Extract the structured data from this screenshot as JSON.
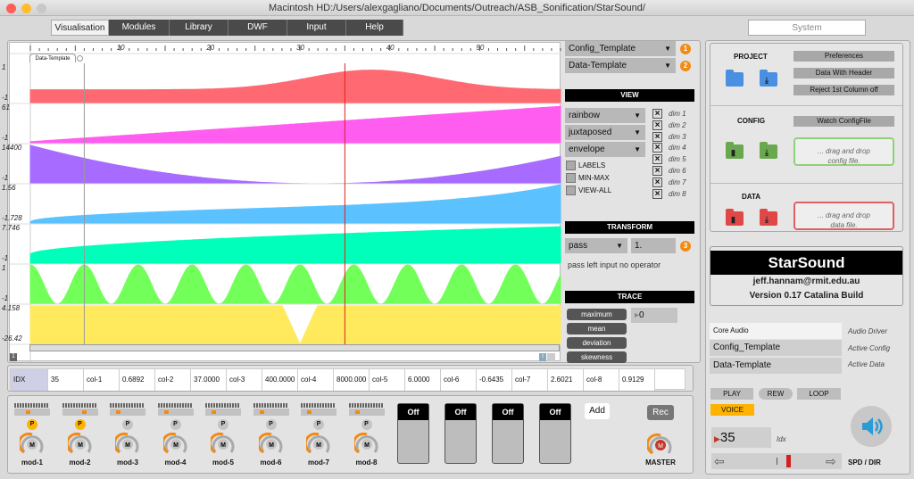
{
  "window": {
    "title": "Macintosh HD:/Users/alexgagliano/Documents/Outreach/ASB_Sonification/StarSound/"
  },
  "tabs": [
    {
      "label": "Visualisation"
    },
    {
      "label": "Modules"
    },
    {
      "label": "Library"
    },
    {
      "label": "DWF"
    },
    {
      "label": "Input"
    },
    {
      "label": "Help"
    }
  ],
  "system_tab": "System",
  "plot": {
    "ruler_ticks": [
      "10",
      "20",
      "30",
      "40",
      "50"
    ],
    "file_tab": "Data-Template",
    "tracks": [
      {
        "max": "1",
        "min": "-1",
        "color": "#ff6a72"
      },
      {
        "max": "61",
        "min": "-1",
        "color": "#ff5cf0"
      },
      {
        "max": "14400",
        "min": "-1",
        "color": "#a76cff"
      },
      {
        "max": "1.56",
        "min": "-1.728",
        "color": "#5bc2ff"
      },
      {
        "max": "7.746",
        "min": "-1",
        "color": "#00ffbb"
      },
      {
        "max": "1",
        "min": "-1",
        "color": "#73ff5a"
      },
      {
        "max": "4.158",
        "min": "-26.42",
        "color": "#ffe95c"
      }
    ],
    "cursor_index": 35,
    "page": "1",
    "info_icon": "i"
  },
  "controls": {
    "config_select": "Config_Template",
    "config_badge": "1",
    "data_select": "Data-Template",
    "data_badge": "2",
    "view_header": "VIEW",
    "color_select": "rainbow",
    "layout_select": "juxtaposed",
    "style_select": "envelope",
    "checks": [
      {
        "label": "LABELS",
        "checked": false
      },
      {
        "label": "MIN-MAX",
        "checked": false
      },
      {
        "label": "VIEW-ALL",
        "checked": false
      }
    ],
    "dims": [
      {
        "label": "dim 1",
        "checked": true
      },
      {
        "label": "dim 2",
        "checked": true
      },
      {
        "label": "dim 3",
        "checked": true
      },
      {
        "label": "dim 4",
        "checked": true
      },
      {
        "label": "dim 5",
        "checked": true
      },
      {
        "label": "dim 6",
        "checked": true
      },
      {
        "label": "dim 7",
        "checked": true
      },
      {
        "label": "dim 8",
        "checked": true
      }
    ],
    "transform_header": "TRANSFORM",
    "transform_select": "pass",
    "transform_value": "1.",
    "transform_badge": "3",
    "transform_desc": "pass left input no operator",
    "trace_header": "TRACE",
    "trace_buttons": [
      "maximum",
      "mean",
      "deviation",
      "skewness"
    ],
    "trace_value": "0"
  },
  "idx_row": [
    "IDX",
    "35",
    "col-1",
    "0.6892",
    "col-2",
    "37.0000",
    "col-3",
    "400.0000",
    "col-4",
    "8000.000",
    "col-5",
    "6.0000",
    "col-6",
    "-0.6435",
    "col-7",
    "2.6021",
    "col-8",
    "0.9129"
  ],
  "mixer": {
    "mods": [
      {
        "label": "mod-1",
        "p": true,
        "level": 0.3
      },
      {
        "label": "mod-2",
        "p": true,
        "level": 0.6
      },
      {
        "label": "mod-3",
        "p": false,
        "level": 0.1
      },
      {
        "label": "mod-4",
        "p": false,
        "level": 0.1
      },
      {
        "label": "mod-5",
        "p": false,
        "level": 0.1
      },
      {
        "label": "mod-6",
        "p": false,
        "level": 0.1
      },
      {
        "label": "mod-7",
        "p": false,
        "level": 0.1
      },
      {
        "label": "mod-8",
        "p": false,
        "level": 0.1
      }
    ],
    "p_label": "P",
    "m_label": "M",
    "offs": [
      "Off",
      "Off",
      "Off",
      "Off"
    ],
    "add": "Add",
    "rec": "Rec",
    "master": "MASTER"
  },
  "system": {
    "project": "PROJECT",
    "config": "CONFIG",
    "data": "DATA",
    "preferences": "Preferences",
    "data_header": "Data With Header",
    "reject": "Reject 1st Column off",
    "watch": "Watch ConfigFile",
    "drop_config": [
      "... drag and drop",
      "config file."
    ],
    "drop_data": [
      "... drag and drop",
      "data file."
    ],
    "app_name": "StarSound",
    "email": "jeff.hannam@rmit.edu.au",
    "version": "Version 0.17 Catalina Build",
    "audio_driver": "Core Audio",
    "audio_driver_label": "Audio Driver",
    "active_config": "Config_Template",
    "active_config_label": "Active Config",
    "active_data": "Data-Template",
    "active_data_label": "Active Data",
    "play": "PLAY",
    "rew": "REW",
    "loop": "LOOP",
    "voice": "VOICE",
    "idx_value": "35",
    "idx_label": "Idx",
    "spd_label": "SPD / DIR"
  }
}
